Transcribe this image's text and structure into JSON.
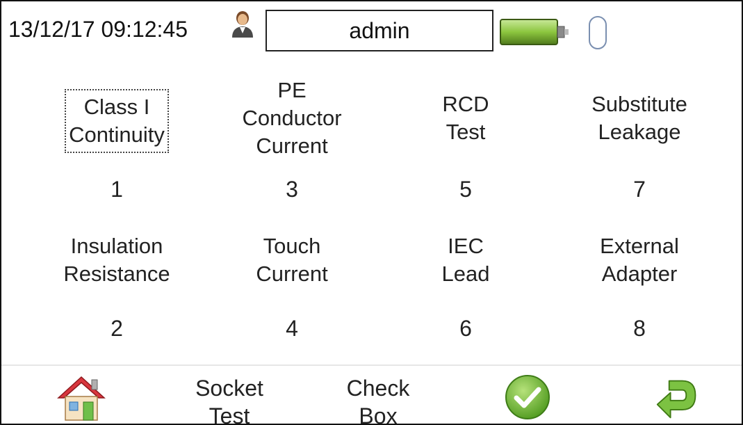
{
  "status": {
    "datetime": "13/12/17 09:12:45",
    "user": "admin",
    "icons": {
      "user": "user-avatar-icon",
      "battery": "battery-icon",
      "mouse": "mouse-icon"
    }
  },
  "tests": [
    {
      "label": "Class I\nContinuity",
      "key": "1",
      "focused": true
    },
    {
      "label": "PE\nConductor\nCurrent",
      "key": "3"
    },
    {
      "label": "RCD\nTest",
      "key": "5"
    },
    {
      "label": "Substitute\nLeakage",
      "key": "7"
    },
    {
      "label": "Insulation\nResistance",
      "key": "2"
    },
    {
      "label": "Touch\nCurrent",
      "key": "4"
    },
    {
      "label": "IEC\nLead",
      "key": "6"
    },
    {
      "label": "External\nAdapter",
      "key": "8"
    }
  ],
  "bottom": {
    "home_icon": "home-icon",
    "socket_test": "Socket\nTest",
    "check_box": "Check\nBox",
    "ok_icon": "checkmark-icon",
    "back_icon": "return-arrow-icon"
  },
  "colors": {
    "battery": "#8cc63f",
    "ok": "#7cc242",
    "back": "#6db33f",
    "home_roof": "#d9363e"
  }
}
